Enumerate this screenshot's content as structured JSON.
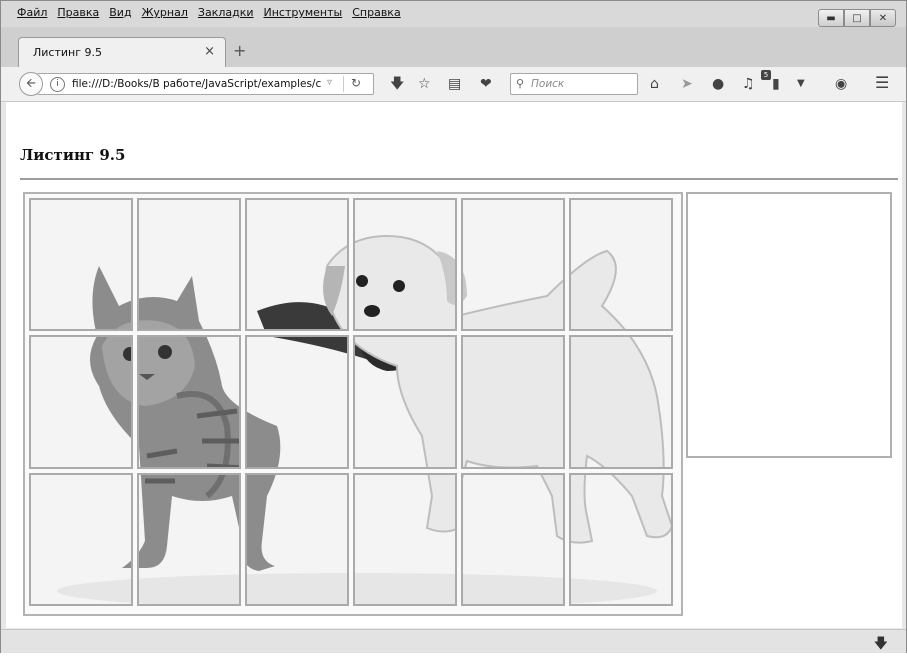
{
  "menu": [
    "Файл",
    "Правка",
    "Вид",
    "Журнал",
    "Закладки",
    "Инструменты",
    "Справка"
  ],
  "tab": {
    "title": "Листинг 9.5",
    "close": "×",
    "new": "+"
  },
  "toolbar": {
    "url": "file:///D:/Books/В работе/JavaScript/examples/cl",
    "search_placeholder": "Поиск",
    "badge": "5"
  },
  "page": {
    "title": "Листинг 9.5"
  },
  "puzzle": {
    "rows": 3,
    "cols": 6
  },
  "icons": [
    "back-arrow-icon",
    "info-icon",
    "reload-icon",
    "download-icon",
    "bookmark-star-icon",
    "reading-list-icon",
    "pocket-icon",
    "search-icon",
    "home-icon",
    "send-icon",
    "chat-icon",
    "music-icon",
    "extension-icon",
    "dropdown-icon",
    "globe-icon",
    "menu-icon"
  ]
}
